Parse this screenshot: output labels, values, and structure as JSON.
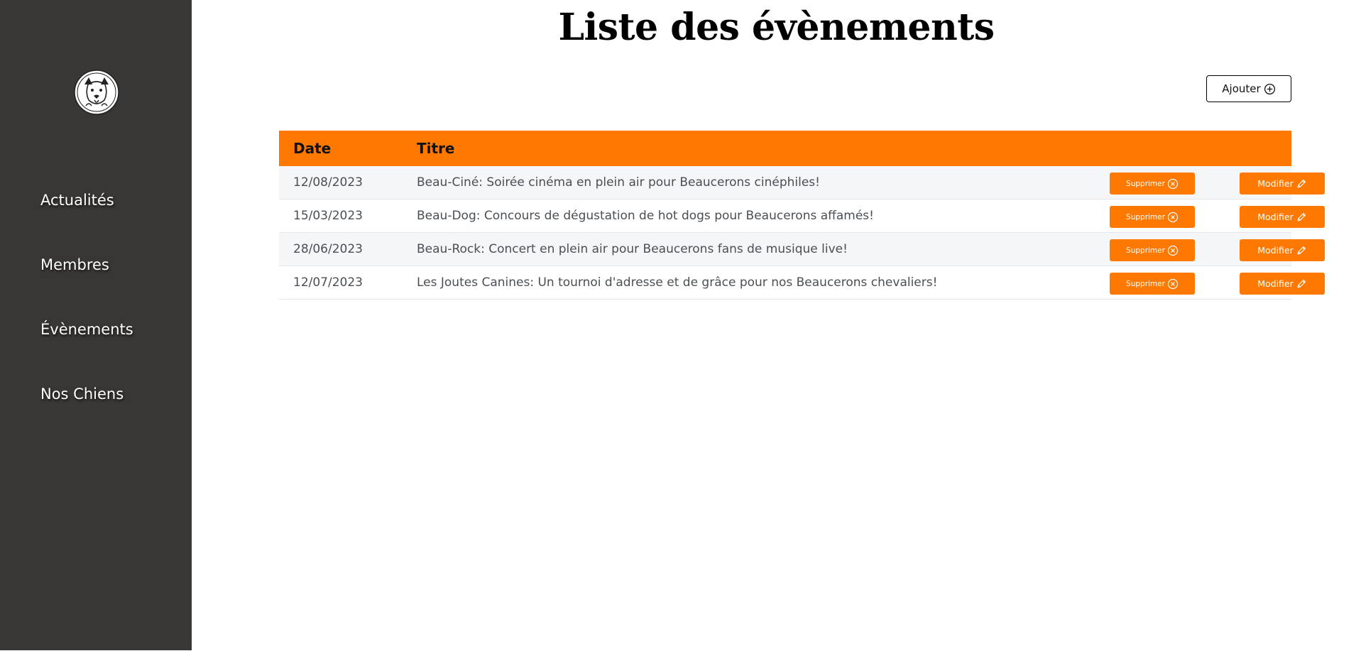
{
  "sidebar": {
    "logo_icon": "beauceron-dog-logo",
    "nav": [
      {
        "label": "Actualités"
      },
      {
        "label": "Membres"
      },
      {
        "label": "Évènements"
      },
      {
        "label": "Nos Chiens"
      }
    ]
  },
  "main": {
    "title": "Liste des évènements",
    "add_label": "Ajouter",
    "add_icon": "plus-circle-icon",
    "table": {
      "headers": {
        "date": "Date",
        "title": "Titre"
      },
      "delete_label": "Supprimer",
      "delete_icon": "x-circle-icon",
      "edit_label": "Modifier",
      "edit_icon": "pencil-icon",
      "rows": [
        {
          "date": "12/08/2023",
          "title": "Beau-Ciné: Soirée cinéma en plein air pour Beaucerons cinéphiles!"
        },
        {
          "date": "15/03/2023",
          "title": "Beau-Dog: Concours de dégustation de hot dogs pour Beaucerons affamés!"
        },
        {
          "date": "28/06/2023",
          "title": "Beau-Rock: Concert en plein air pour Beaucerons fans de musique live!"
        },
        {
          "date": "12/07/2023",
          "title": "Les Joutes Canines: Un tournoi d'adresse et de grâce pour nos Beaucerons chevaliers!"
        }
      ]
    }
  },
  "colors": {
    "sidebar_bg": "#393735",
    "accent": "#ff7900",
    "row_alt": "#f5f6f8"
  }
}
